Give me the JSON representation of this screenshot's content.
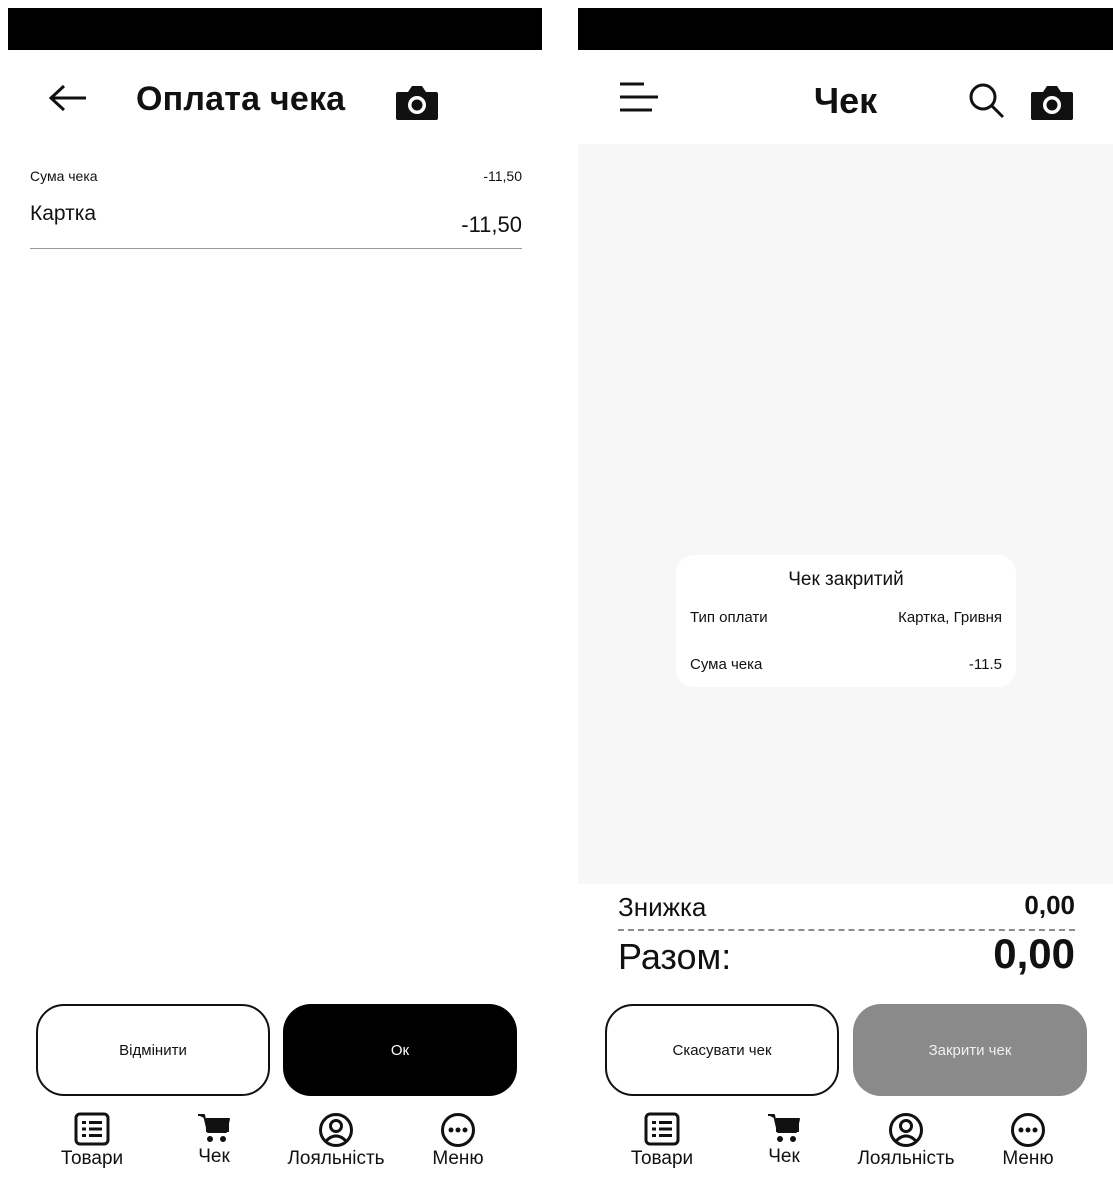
{
  "left_screen": {
    "header": {
      "title": "Оплата чека",
      "back_icon": "arrow-left-icon",
      "camera_icon": "camera-icon"
    },
    "sum_row": {
      "label": "Сума чека",
      "value": "-11,50"
    },
    "payment_row": {
      "label": "Картка",
      "value": "-11,50"
    },
    "buttons": {
      "cancel_label": "Відмінити",
      "ok_label": "Ок"
    }
  },
  "right_screen": {
    "header": {
      "title": "Чек",
      "menu_icon": "menu-icon",
      "search_icon": "search-icon",
      "camera_icon": "camera-icon"
    },
    "dialog": {
      "title": "Чек закритий",
      "rows": [
        {
          "label": "Тип оплати",
          "value": "Картка, Гривня"
        },
        {
          "label": "Сума чека",
          "value": "-11.5"
        }
      ]
    },
    "summary": {
      "discount_label": "Знижка",
      "discount_value": "0,00",
      "total_label": "Разом:",
      "total_value": "0,00"
    },
    "buttons": {
      "cancel_label": "Скасувати чек",
      "close_label": "Закрити чек"
    }
  },
  "bottom_nav": {
    "items": [
      {
        "label": "Товари",
        "icon": "list-icon"
      },
      {
        "label": "Чек",
        "icon": "cart-icon"
      },
      {
        "label": "Лояльність",
        "icon": "user-circle-icon"
      },
      {
        "label": "Меню",
        "icon": "more-icon"
      }
    ]
  },
  "colors": {
    "primary": "#000000",
    "disabled": "#8a8a8a",
    "background_gray": "#f7f7f7",
    "text": "#111111"
  }
}
